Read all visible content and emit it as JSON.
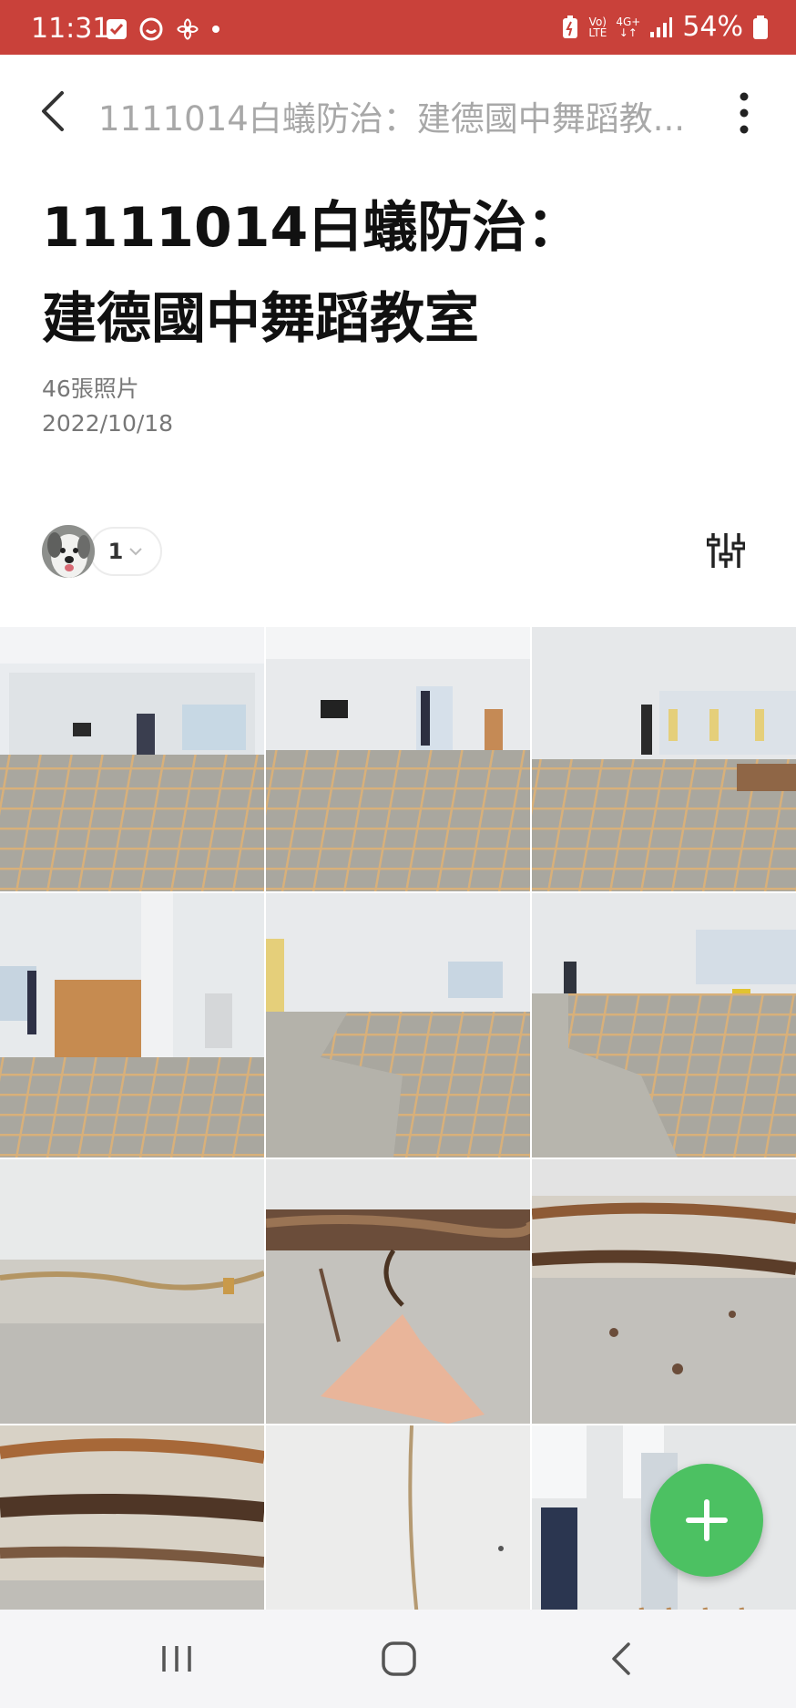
{
  "status_bar": {
    "time": "11:31",
    "battery": "54%",
    "network_top": "Vo)",
    "network_bottom": "LTE",
    "mobile_top": "4G+",
    "mobile_bottom": "↓↑"
  },
  "app_bar": {
    "title": "1111014白蟻防治：建德國中舞蹈教..."
  },
  "album": {
    "title_line1": "1111014白蟻防治：",
    "title_line2": "建德國中舞蹈教室",
    "photo_count": "46張照片",
    "date": "2022/10/18"
  },
  "members": {
    "count": "1"
  },
  "icons": {
    "back": "chevron-left-icon",
    "more": "more-vertical-icon",
    "filter": "sliders-icon",
    "fab": "plus-icon",
    "nav_recents": "recents-icon",
    "nav_home": "home-icon",
    "nav_back": "back-icon"
  },
  "colors": {
    "status_bar": "#c9413a",
    "fab": "#4cc162",
    "title": "#111111",
    "subtitle": "#777777"
  }
}
